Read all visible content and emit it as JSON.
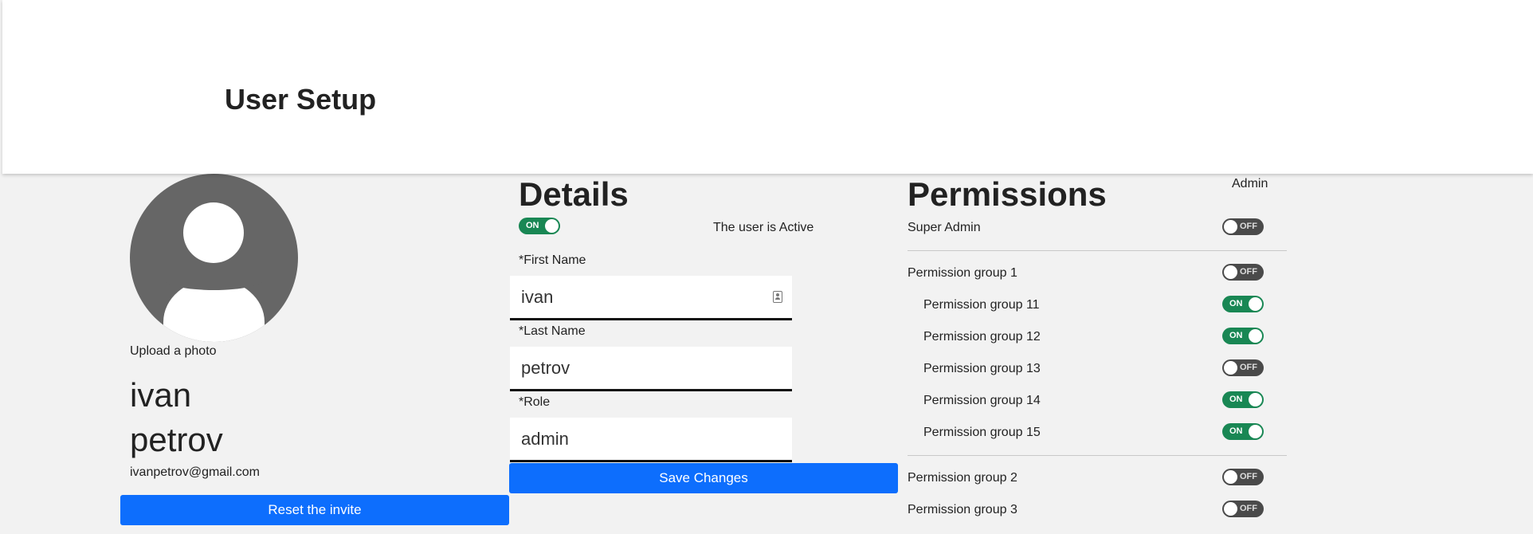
{
  "header": {
    "title": "User Setup"
  },
  "profile": {
    "upload_label": "Upload a photo",
    "first_name": "ivan",
    "last_name": "petrov",
    "email": "ivanpetrov@gmail.com",
    "reset_label": "Reset the invite"
  },
  "details": {
    "title": "Details",
    "active_toggle_label": "ON",
    "active_text": "The user is Active",
    "first_name_label": "*First Name",
    "first_name_value": "ivan",
    "last_name_label": "*Last Name",
    "last_name_value": "petrov",
    "role_label": "*Role",
    "role_value": "admin",
    "save_label": "Save Changes"
  },
  "permissions": {
    "title": "Permissions",
    "column_header": "Admin",
    "rows": [
      {
        "label": "Super Admin",
        "toggle": "OFF"
      },
      {
        "label": "Permission group 1",
        "toggle": "OFF"
      },
      {
        "label": "Permission group 11",
        "toggle": "ON"
      },
      {
        "label": "Permission group 12",
        "toggle": "ON"
      },
      {
        "label": "Permission group 13",
        "toggle": "OFF"
      },
      {
        "label": "Permission group 14",
        "toggle": "ON"
      },
      {
        "label": "Permission group 15",
        "toggle": "ON"
      },
      {
        "label": "Permission group 2",
        "toggle": "OFF"
      },
      {
        "label": "Permission group 3",
        "toggle": "OFF"
      }
    ]
  },
  "colors": {
    "primary": "#0d6efd",
    "toggle_on": "#198754",
    "toggle_off": "#4a4a4a",
    "avatar": "#666666"
  }
}
